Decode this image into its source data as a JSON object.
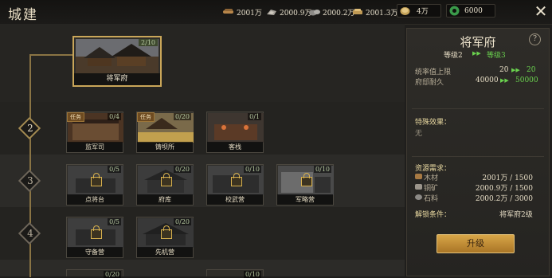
{
  "header": {
    "title": "城建",
    "resources": [
      {
        "icon": "wood-icon",
        "value": "2001万"
      },
      {
        "icon": "copper-icon",
        "value": "2000.9万"
      },
      {
        "icon": "stone-icon",
        "value": "2000.2万"
      },
      {
        "icon": "iron-icon",
        "value": "2001.3万"
      }
    ],
    "coin_value": "4万",
    "jade_value": "6000"
  },
  "tree": {
    "main": {
      "name": "将军府",
      "count": "2/10"
    },
    "tiers": [
      {
        "level": "2",
        "buildings": [
          {
            "name": "监军司",
            "count": "0/4",
            "tag": "任务",
            "locked": false
          },
          {
            "name": "铸坝所",
            "count": "0/20",
            "tag": "任务",
            "locked": false
          },
          {
            "name": "客栈",
            "count": "0/1",
            "tag": "",
            "locked": false
          }
        ]
      },
      {
        "level": "3",
        "buildings": [
          {
            "name": "点将台",
            "count": "0/5",
            "locked": true
          },
          {
            "name": "府库",
            "count": "0/20",
            "locked": true
          },
          {
            "name": "校武营",
            "count": "0/10",
            "locked": true
          },
          {
            "name": "军略营",
            "count": "0/10",
            "locked": true
          }
        ]
      },
      {
        "level": "4",
        "buildings": [
          {
            "name": "守备营",
            "count": "0/5",
            "locked": true
          },
          {
            "name": "先机营",
            "count": "0/20",
            "locked": true
          }
        ]
      },
      {
        "level": "",
        "buildings": [
          {
            "name": "",
            "count": "0/20",
            "locked": true
          },
          {
            "name": "",
            "count": "0/10",
            "locked": true
          }
        ]
      }
    ]
  },
  "panel": {
    "title": "将军府",
    "level_from": "等级2",
    "level_to": "等级3",
    "stats": [
      {
        "label": "统率值上限",
        "from": "20",
        "to": "20"
      },
      {
        "label": "府邸耐久",
        "from": "40000",
        "to": "50000"
      }
    ],
    "special_label": "特殊效果：",
    "special_value": "无",
    "req_label": "资源需求：",
    "requirements": [
      {
        "icon": "wood-icon",
        "label": "木材",
        "value": "2001万 / 1500"
      },
      {
        "icon": "copper-icon",
        "label": "铜矿",
        "value": "2000.9万 / 1500"
      },
      {
        "icon": "stone-icon",
        "label": "石料",
        "value": "2000.2万 / 3000"
      }
    ],
    "unlock_label": "解锁条件：",
    "unlock_value": "将军府2级",
    "upgrade_label": "升级"
  }
}
